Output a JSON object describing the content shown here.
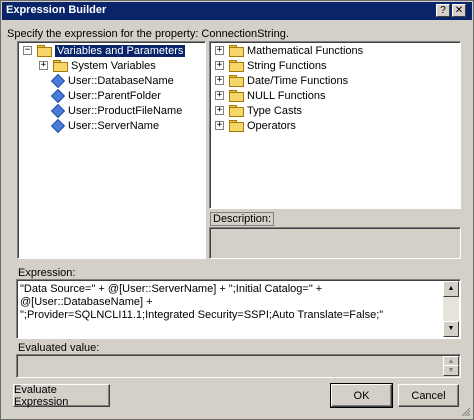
{
  "window": {
    "title": "Expression Builder",
    "controls": {
      "help": "?",
      "close": "✕"
    }
  },
  "instruction": "Specify the expression for the property: ConnectionString.",
  "variables_tree": {
    "root_label": "Variables and Parameters",
    "items": [
      {
        "label": "System Variables",
        "type": "folder",
        "expander": "+"
      },
      {
        "label": "User::DatabaseName",
        "type": "variable"
      },
      {
        "label": "User::ParentFolder",
        "type": "variable"
      },
      {
        "label": "User::ProductFileName",
        "type": "variable"
      },
      {
        "label": "User::ServerName",
        "type": "variable"
      }
    ],
    "root_expander": "−"
  },
  "functions_tree": {
    "items": [
      {
        "label": "Mathematical Functions",
        "expander": "+"
      },
      {
        "label": "String Functions",
        "expander": "+"
      },
      {
        "label": "Date/Time Functions",
        "expander": "+"
      },
      {
        "label": "NULL Functions",
        "expander": "+"
      },
      {
        "label": "Type Casts",
        "expander": "+"
      },
      {
        "label": "Operators",
        "expander": "+"
      }
    ]
  },
  "description": {
    "label": "Description:"
  },
  "expression": {
    "label": "Expression:",
    "line1": "\"Data Source=\" + @[User::ServerName]  + \";Initial Catalog=\" + @[User::DatabaseName]  +",
    "line2": "\";Provider=SQLNCLI11.1;Integrated Security=SSPI;Auto Translate=False;\""
  },
  "evaluated": {
    "label": "Evaluated value:"
  },
  "buttons": {
    "evaluate": "Evaluate Expression",
    "ok": "OK",
    "cancel": "Cancel"
  }
}
